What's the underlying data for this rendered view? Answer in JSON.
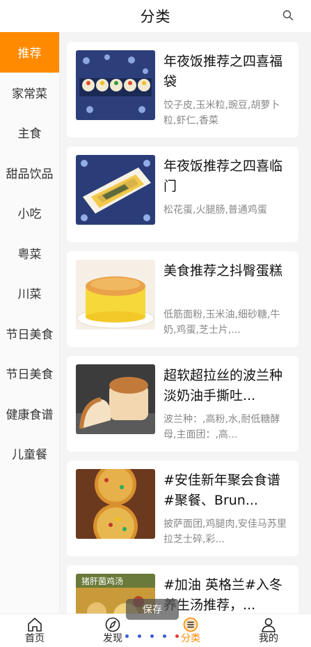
{
  "header": {
    "title": "分类",
    "search_icon": "search-icon"
  },
  "sidebar": {
    "items": [
      {
        "label": "推荐"
      },
      {
        "label": "家常菜"
      },
      {
        "label": "主食"
      },
      {
        "label": "甜品饮品"
      },
      {
        "label": "小吃"
      },
      {
        "label": "粤菜"
      },
      {
        "label": "川菜"
      },
      {
        "label": "节日美食"
      },
      {
        "label": "节日美食"
      },
      {
        "label": "健康食谱"
      },
      {
        "label": "儿童餐"
      }
    ],
    "active_color": "#ff8a00"
  },
  "recipes": [
    {
      "title": "年夜饭推荐之四喜福袋",
      "desc": "饺子皮,玉米粒,豌豆,胡萝卜粒,虾仁,香菜"
    },
    {
      "title": "年夜饭推荐之四喜临门",
      "desc": "松花蛋,火腿肠,普通鸡蛋"
    },
    {
      "title": "美食推荐之抖臀蛋糕",
      "desc": "低筋面粉,玉米油,细砂糖,牛奶,鸡蛋,芝士片,..."
    },
    {
      "title": "超软超拉丝的波兰种淡奶油手撕吐...",
      "desc": "波兰种：,高粉,水,耐低糖酵母,主面团：,高..."
    },
    {
      "title": "#安佳新年聚会食谱#聚餐、Brun...",
      "desc": "披萨面团,鸡腿肉,安佳马苏里拉芝士碎,彩..."
    },
    {
      "title": "#加油 英格兰#入冬养生汤推荐，...",
      "desc": "",
      "thumb_text": "猪肝菌鸡汤"
    }
  ],
  "toast": {
    "text": "保存"
  },
  "tabbar": {
    "tabs": [
      {
        "label": "首页",
        "icon": "home-icon"
      },
      {
        "label": "发现",
        "icon": "compass-icon"
      },
      {
        "label": "分类",
        "icon": "category-icon"
      },
      {
        "label": "我的",
        "icon": "profile-icon"
      }
    ],
    "active_index": 2
  }
}
